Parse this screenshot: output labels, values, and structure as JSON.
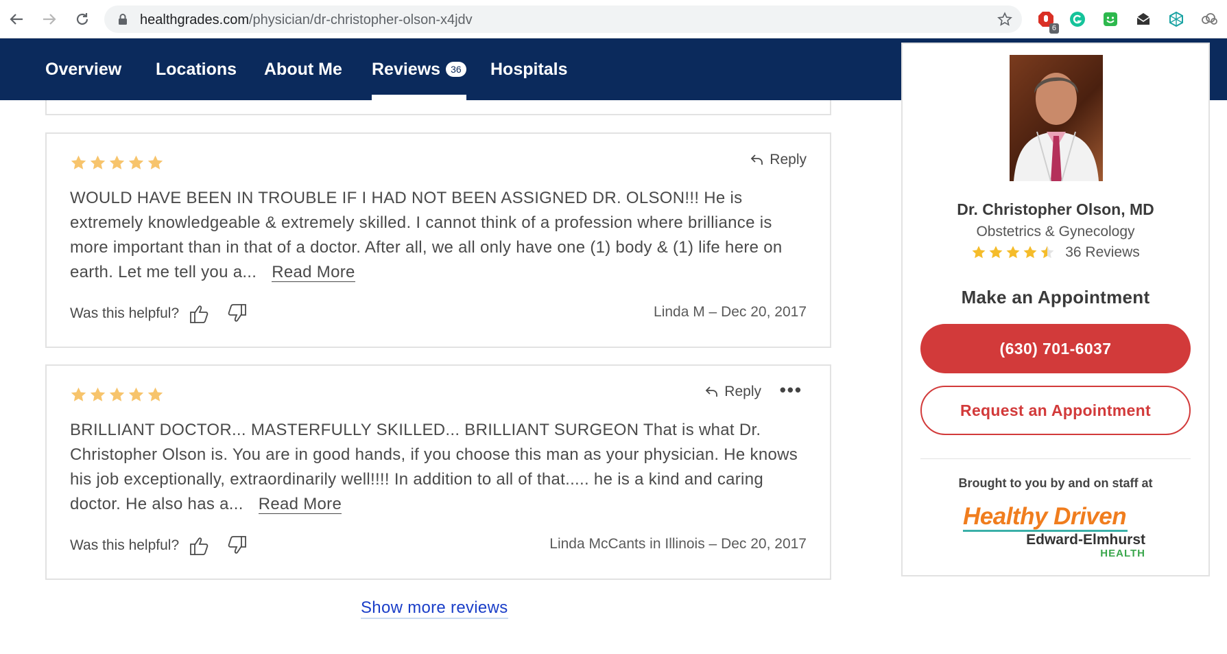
{
  "browser": {
    "url_host": "healthgrades.com",
    "url_path": "/physician/dr-christopher-olson-x4jdv",
    "extension_badge": "6"
  },
  "nav": {
    "tabs": [
      {
        "label": "Overview"
      },
      {
        "label": "Locations"
      },
      {
        "label": "About Me"
      },
      {
        "label": "Reviews",
        "count": "36",
        "active": true
      },
      {
        "label": "Hospitals"
      }
    ]
  },
  "reviews": [
    {
      "rating": 5,
      "reply_label": "Reply",
      "text": "WOULD HAVE BEEN IN TROUBLE IF I HAD NOT BEEN ASSIGNED DR. OLSON!!! He is extremely knowledgeable & extremely skilled. I cannot think of a profession where brilliance is more important than in that of a doctor. After all, we all only have one (1) body & (1) life here on earth. Let me tell you a...",
      "read_more": "Read More",
      "helpful_label": "Was this helpful?",
      "byline": "Linda M – Dec 20, 2017"
    },
    {
      "rating": 5,
      "reply_label": "Reply",
      "more_menu": "•••",
      "text": "BRILLIANT DOCTOR... MASTERFULLY SKILLED... BRILLIANT SURGEON That is what Dr. Christopher Olson is. You are in good hands, if you choose this man as your physician. He knows his job exceptionally, extraordinarily well!!!! In addition to all of that..... he is a kind and caring doctor. He also has a...",
      "read_more": "Read More",
      "helpful_label": "Was this helpful?",
      "byline": "Linda McCants in Illinois – Dec 20, 2017"
    }
  ],
  "show_more": "Show more reviews",
  "sidebar": {
    "name": "Dr. Christopher Olson, MD",
    "specialty": "Obstetrics & Gynecology",
    "rating": 4.5,
    "reviews_count": "36 Reviews",
    "appt_heading": "Make an Appointment",
    "phone": "(630) 701-6037",
    "request_label": "Request an Appointment",
    "brought_by": "Brought to you by and on staff at",
    "logo": {
      "main": "Healthy Driven",
      "sub": "Edward-Elmhurst",
      "sub2": "HEALTH"
    }
  },
  "colors": {
    "nav_bg": "#0b2a5c",
    "star": "#f7c46c",
    "cta_red": "#d23a3a",
    "link_blue": "#1a3ec8"
  }
}
